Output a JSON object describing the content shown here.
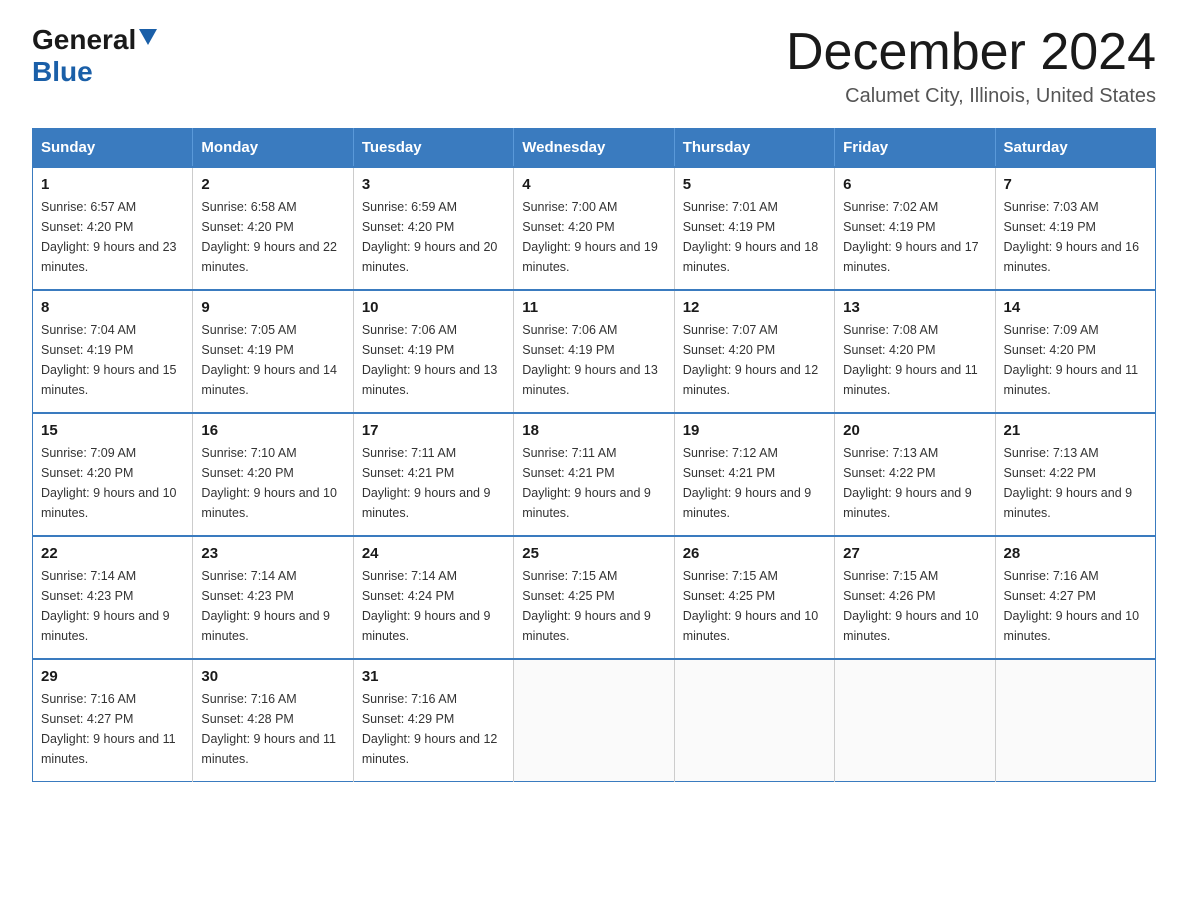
{
  "header": {
    "logo_line1": "General",
    "logo_line2": "Blue",
    "month_title": "December 2024",
    "location": "Calumet City, Illinois, United States"
  },
  "calendar": {
    "weekdays": [
      "Sunday",
      "Monday",
      "Tuesday",
      "Wednesday",
      "Thursday",
      "Friday",
      "Saturday"
    ],
    "weeks": [
      [
        {
          "day": "1",
          "sunrise": "6:57 AM",
          "sunset": "4:20 PM",
          "daylight": "9 hours and 23 minutes."
        },
        {
          "day": "2",
          "sunrise": "6:58 AM",
          "sunset": "4:20 PM",
          "daylight": "9 hours and 22 minutes."
        },
        {
          "day": "3",
          "sunrise": "6:59 AM",
          "sunset": "4:20 PM",
          "daylight": "9 hours and 20 minutes."
        },
        {
          "day": "4",
          "sunrise": "7:00 AM",
          "sunset": "4:20 PM",
          "daylight": "9 hours and 19 minutes."
        },
        {
          "day": "5",
          "sunrise": "7:01 AM",
          "sunset": "4:19 PM",
          "daylight": "9 hours and 18 minutes."
        },
        {
          "day": "6",
          "sunrise": "7:02 AM",
          "sunset": "4:19 PM",
          "daylight": "9 hours and 17 minutes."
        },
        {
          "day": "7",
          "sunrise": "7:03 AM",
          "sunset": "4:19 PM",
          "daylight": "9 hours and 16 minutes."
        }
      ],
      [
        {
          "day": "8",
          "sunrise": "7:04 AM",
          "sunset": "4:19 PM",
          "daylight": "9 hours and 15 minutes."
        },
        {
          "day": "9",
          "sunrise": "7:05 AM",
          "sunset": "4:19 PM",
          "daylight": "9 hours and 14 minutes."
        },
        {
          "day": "10",
          "sunrise": "7:06 AM",
          "sunset": "4:19 PM",
          "daylight": "9 hours and 13 minutes."
        },
        {
          "day": "11",
          "sunrise": "7:06 AM",
          "sunset": "4:19 PM",
          "daylight": "9 hours and 13 minutes."
        },
        {
          "day": "12",
          "sunrise": "7:07 AM",
          "sunset": "4:20 PM",
          "daylight": "9 hours and 12 minutes."
        },
        {
          "day": "13",
          "sunrise": "7:08 AM",
          "sunset": "4:20 PM",
          "daylight": "9 hours and 11 minutes."
        },
        {
          "day": "14",
          "sunrise": "7:09 AM",
          "sunset": "4:20 PM",
          "daylight": "9 hours and 11 minutes."
        }
      ],
      [
        {
          "day": "15",
          "sunrise": "7:09 AM",
          "sunset": "4:20 PM",
          "daylight": "9 hours and 10 minutes."
        },
        {
          "day": "16",
          "sunrise": "7:10 AM",
          "sunset": "4:20 PM",
          "daylight": "9 hours and 10 minutes."
        },
        {
          "day": "17",
          "sunrise": "7:11 AM",
          "sunset": "4:21 PM",
          "daylight": "9 hours and 9 minutes."
        },
        {
          "day": "18",
          "sunrise": "7:11 AM",
          "sunset": "4:21 PM",
          "daylight": "9 hours and 9 minutes."
        },
        {
          "day": "19",
          "sunrise": "7:12 AM",
          "sunset": "4:21 PM",
          "daylight": "9 hours and 9 minutes."
        },
        {
          "day": "20",
          "sunrise": "7:13 AM",
          "sunset": "4:22 PM",
          "daylight": "9 hours and 9 minutes."
        },
        {
          "day": "21",
          "sunrise": "7:13 AM",
          "sunset": "4:22 PM",
          "daylight": "9 hours and 9 minutes."
        }
      ],
      [
        {
          "day": "22",
          "sunrise": "7:14 AM",
          "sunset": "4:23 PM",
          "daylight": "9 hours and 9 minutes."
        },
        {
          "day": "23",
          "sunrise": "7:14 AM",
          "sunset": "4:23 PM",
          "daylight": "9 hours and 9 minutes."
        },
        {
          "day": "24",
          "sunrise": "7:14 AM",
          "sunset": "4:24 PM",
          "daylight": "9 hours and 9 minutes."
        },
        {
          "day": "25",
          "sunrise": "7:15 AM",
          "sunset": "4:25 PM",
          "daylight": "9 hours and 9 minutes."
        },
        {
          "day": "26",
          "sunrise": "7:15 AM",
          "sunset": "4:25 PM",
          "daylight": "9 hours and 10 minutes."
        },
        {
          "day": "27",
          "sunrise": "7:15 AM",
          "sunset": "4:26 PM",
          "daylight": "9 hours and 10 minutes."
        },
        {
          "day": "28",
          "sunrise": "7:16 AM",
          "sunset": "4:27 PM",
          "daylight": "9 hours and 10 minutes."
        }
      ],
      [
        {
          "day": "29",
          "sunrise": "7:16 AM",
          "sunset": "4:27 PM",
          "daylight": "9 hours and 11 minutes."
        },
        {
          "day": "30",
          "sunrise": "7:16 AM",
          "sunset": "4:28 PM",
          "daylight": "9 hours and 11 minutes."
        },
        {
          "day": "31",
          "sunrise": "7:16 AM",
          "sunset": "4:29 PM",
          "daylight": "9 hours and 12 minutes."
        },
        null,
        null,
        null,
        null
      ]
    ]
  }
}
